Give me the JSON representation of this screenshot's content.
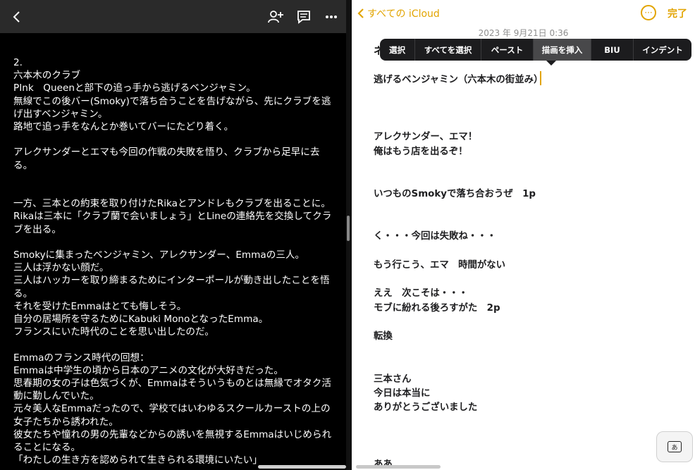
{
  "left": {
    "text": "2.\n六本木のクラブ\nPInk　Queenと部下の追っ手から逃げるベンジャミン。\n無線でこの後バー(Smoky)で落ち合うことを告げながら、先にクラブを逃げ出すベンジャミン。\n路地で追っ手をなんとか巻いてバーにたどり着く。\n\nアレクサンダーとエマも今回の作戦の失敗を悟り、クラブから足早に去る。\n\n\n一方、三本との約束を取り付けたRikaとアンドレもクラブを出ることに。\nRikaは三本に「クラブ蘭で会いましょう」とLineの連絡先を交換してクラブを出る。\n\nSmokyに集まったベンジャミン、アレクサンダー、Emmaの三人。\n三人は浮かない顔だ。\n三人はハッカーを取り締まるためにインターポールが動き出したことを悟る。\nそれを受けたEmmaはとても悔しそう。\n自分の居場所を守るためにKabuki MonoとなったEmma。\nフランスにいた時代のことを思い出したのだ。\n\nEmmaのフランス時代の回想：\nEmmaは中学生の頃から日本のアニメの文化が大好きだった。\n思春期の女の子は色気づくが、Emmaはそういうものとは無縁でオタク活動に勤しんでいた。\n元々美人なEmmaだったので、学校ではいわゆるスクールカーストの上の女子たちから誘われた。\n彼女たちや憧れの男の先輩などからの誘いを無視するEmmaはいじめられることになる。\n「わたしの生き方を認められて生きられる環境にいたい」"
  },
  "icons": {
    "back": "chevron-left-icon",
    "add_person": "add-person-icon",
    "comment": "comment-icon",
    "more": "more-icon"
  },
  "right": {
    "nav_back_label": "すべての iCloud",
    "done_label": "完了",
    "date": "2023 年 9月21日 0:36",
    "menu": [
      "選択",
      "すべてを選択",
      "ペースト",
      "描画を挿入",
      "BIU",
      "インデント"
    ],
    "note_head": "ネ",
    "lines": [
      "逃げるベンジャミン（六本木の街並み）",
      "アレクサンダー、エマ！",
      "俺はもう店を出るぞ！",
      "いつものSmokyで落ち合おうぜ　1p",
      "く・・・今回は失敗ね・・・",
      "もう行こう、エマ　時間がない",
      "ええ　次こそは・・・",
      "モブに紛れる後ろすがた　2p",
      "転換",
      "三本さん",
      "今日は本当に",
      "ありがとうございました",
      "ああ"
    ],
    "kb_label": "あ"
  },
  "colors": {
    "accent": "#e2a400",
    "left_bg": "#000000",
    "left_bar": "#2a2a2a",
    "menu_bg": "#1c1c1e"
  }
}
